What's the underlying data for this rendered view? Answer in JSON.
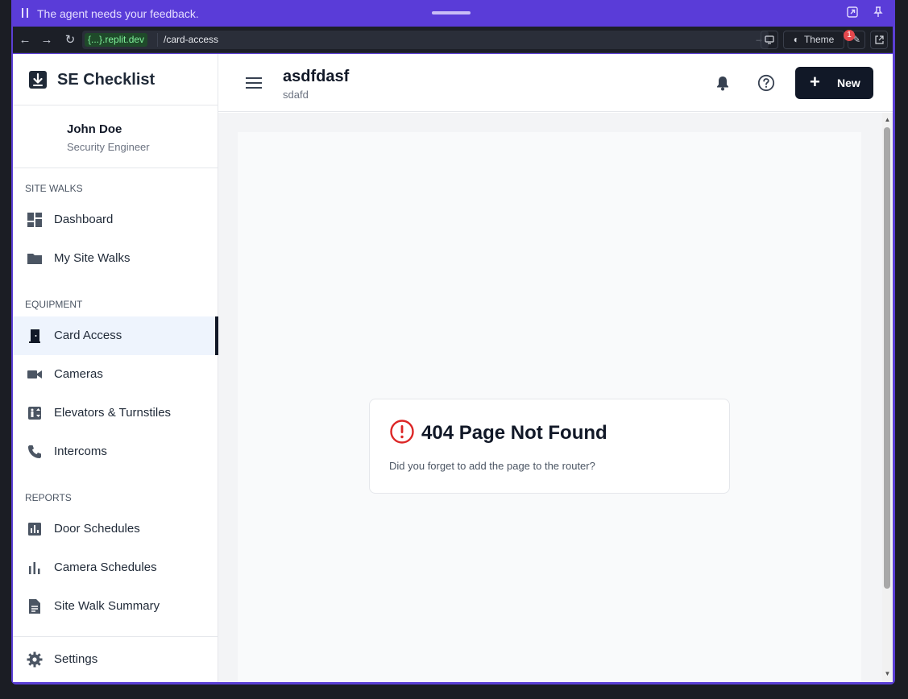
{
  "agent_bar": {
    "message": "The agent needs your feedback."
  },
  "browser": {
    "domain": "{...}.replit.dev",
    "path": "/card-access",
    "theme_label": "Theme",
    "badge_count": "1"
  },
  "sidebar": {
    "brand": "SE Checklist",
    "user": {
      "name": "John Doe",
      "role": "Security Engineer"
    },
    "sections": {
      "site_walks": "SITE WALKS",
      "equipment": "EQUIPMENT",
      "reports": "REPORTS"
    },
    "items": [
      {
        "label": "Dashboard",
        "icon": "dashboard-icon"
      },
      {
        "label": "My Site Walks",
        "icon": "folder-icon"
      },
      {
        "label": "Card Access",
        "icon": "door-icon",
        "active": true
      },
      {
        "label": "Cameras",
        "icon": "video-camera-icon"
      },
      {
        "label": "Elevators & Turnstiles",
        "icon": "elevator-icon"
      },
      {
        "label": "Intercoms",
        "icon": "phone-icon"
      },
      {
        "label": "Door Schedules",
        "icon": "bar-chart-icon"
      },
      {
        "label": "Camera Schedules",
        "icon": "bar-chart-icon"
      },
      {
        "label": "Site Walk Summary",
        "icon": "document-icon"
      }
    ],
    "settings_label": "Settings"
  },
  "header": {
    "title": "asdfdasf",
    "subtitle": "sdafd",
    "new_button": "New"
  },
  "not_found": {
    "title": "404 Page Not Found",
    "message": "Did you forget to add the page to the router?"
  },
  "colors": {
    "agent_bar": "#5a3cd8",
    "primary_button": "#111827",
    "error_icon": "#dc2626",
    "active_item_bg": "#eef4fd"
  }
}
